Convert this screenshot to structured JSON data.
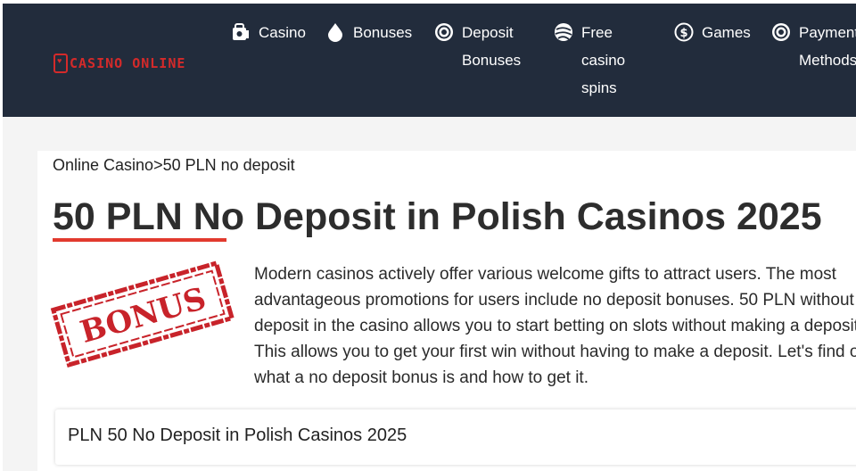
{
  "header": {
    "logo_text": "CASINO ONLINE",
    "nav": [
      {
        "label": "Casino",
        "icon": "casino-chip-icon"
      },
      {
        "label": "Bonuses",
        "icon": "drop-icon"
      },
      {
        "label": "Deposit\nBonuses",
        "icon": "poker-chip-icon"
      },
      {
        "label": "Free\ncasino\nspins",
        "icon": "spin-ball-icon"
      },
      {
        "label": "Games",
        "icon": "dollar-coin-icon"
      },
      {
        "label": "Payment\nMethods",
        "icon": "payment-chip-icon"
      }
    ]
  },
  "breadcrumb": {
    "home": "Online Casino",
    "separator": ">",
    "current": "50 PLN no deposit"
  },
  "page": {
    "title": "50 PLN No Deposit in Polish Casinos 2025",
    "stamp_text": "BONUS",
    "intro": "Modern casinos actively offer various welcome gifts to attract users. The most advantageous promotions for users include no deposit bonuses. 50 PLN without deposit in the casino allows you to start betting on slots without making a deposit. This allows you to get your first win without having to make a deposit. Let's find out what a no deposit bonus is and how to get it.",
    "toc_title": "PLN 50 No Deposit in Polish Casinos 2025"
  },
  "colors": {
    "header_bg": "#222c3c",
    "accent_red": "#e23a2e",
    "logo_red": "#d42a2a"
  }
}
